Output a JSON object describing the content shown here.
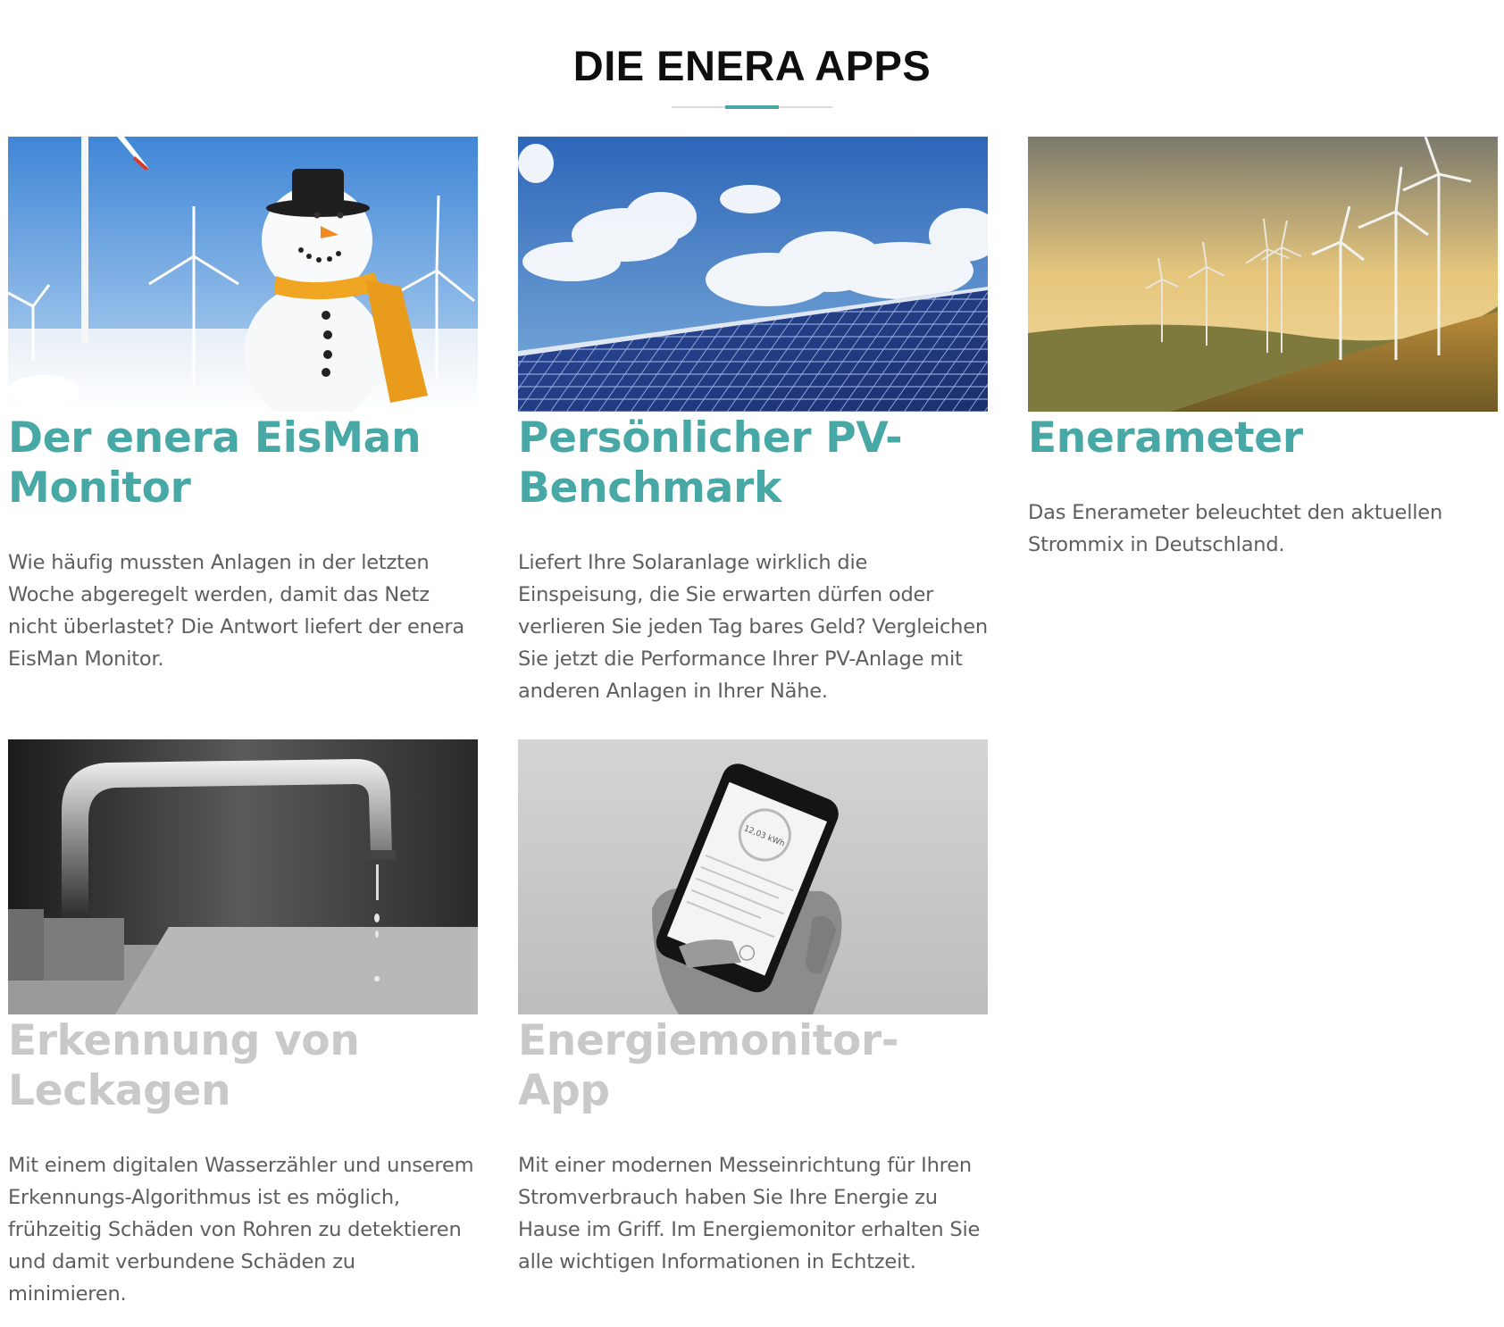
{
  "section": {
    "heading": "DIE ENERA APPS"
  },
  "colors": {
    "accent": "#47a8a5",
    "inactive_title": "#c9c9c9",
    "body_text": "#5e5e5e",
    "heading": "#0e0e0e"
  },
  "apps": [
    {
      "image": "snowman-windfarm-image",
      "title": "Der enera EisMan Monitor",
      "description": "Wie häufig mussten Anlagen in der letzten Woche abgeregelt werden, damit das Netz nicht überlastet? Die Antwort liefert der enera EisMan Monitor.",
      "state": "active"
    },
    {
      "image": "solar-panel-image",
      "title": "Persönlicher PV-Benchmark",
      "description": "Liefert Ihre Solaranlage wirklich die Einspeisung, die Sie erwarten dürfen oder verlieren Sie jeden Tag bares Geld? Vergleichen Sie jetzt die Performance Ihrer PV-Anlage mit anderen Anlagen in Ihrer Nähe.",
      "state": "active"
    },
    {
      "image": "wind-turbines-sunset-image",
      "title": "Enerameter",
      "description": "Das Enerameter beleuchtet den aktuellen Strommix in Deutschland.",
      "state": "active"
    },
    {
      "image": "water-faucet-image",
      "title": "Erkennung von Leckagen",
      "description": "Mit einem digitalen Wasserzähler und unserem Erkennungs-Algorithmus ist es möglich, frühzeitig Schäden von Rohren zu detektieren und damit verbundene Schäden zu minimieren.",
      "state": "inactive"
    },
    {
      "image": "smartphone-hand-image",
      "title": "Energiemonitor-App",
      "description": "Mit einer modernen Messeinrichtung für Ihren Stromverbrauch haben Sie Ihre Energie zu Hause im Griff. Im Energiemonitor erhalten Sie alle wichtigen Informationen in Echtzeit.",
      "state": "inactive",
      "phone_screen_reading": "12,03 kWh"
    }
  ]
}
